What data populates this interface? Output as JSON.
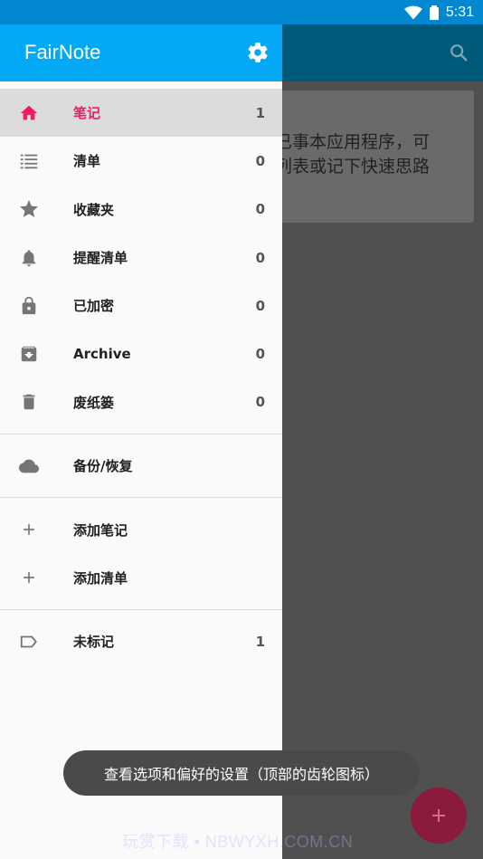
{
  "status_bar": {
    "time": "5:31"
  },
  "background": {
    "card_lines": [
      "已事本应用程序，可",
      "列表或记下快速思路"
    ]
  },
  "drawer": {
    "title": "FairNote",
    "items": [
      {
        "label": "笔记",
        "count": "1",
        "icon": "home-icon"
      },
      {
        "label": "清单",
        "count": "0",
        "icon": "list-icon"
      },
      {
        "label": "收藏夹",
        "count": "0",
        "icon": "star-icon"
      },
      {
        "label": "提醒清单",
        "count": "0",
        "icon": "bell-icon"
      },
      {
        "label": "已加密",
        "count": "0",
        "icon": "lock-icon"
      },
      {
        "label": "Archive",
        "count": "0",
        "icon": "archive-icon"
      },
      {
        "label": "废纸篓",
        "count": "0",
        "icon": "trash-icon"
      }
    ],
    "backup": {
      "label": "备份/恢复",
      "icon": "cloud-icon"
    },
    "add_note": {
      "label": "添加笔记",
      "icon": "plus-icon"
    },
    "add_list": {
      "label": "添加清单",
      "icon": "plus-icon"
    },
    "untagged": {
      "label": "未标记",
      "count": "1",
      "icon": "label-icon"
    }
  },
  "toast": {
    "text": "查看选项和偏好的设置（顶部的齿轮图标）"
  },
  "watermark": "玩赏下载 • NBWYXH.COM.CN",
  "colors": {
    "accent": "#e91e63",
    "drawer_header": "#03a9f4",
    "status_bar": "#0288d1"
  }
}
